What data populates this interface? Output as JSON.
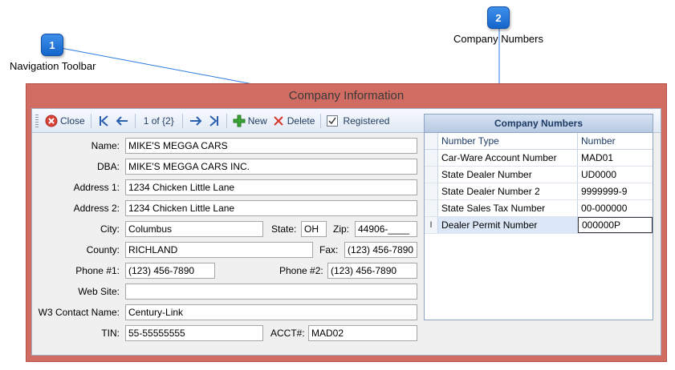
{
  "callouts": [
    {
      "number": "1",
      "label": "Navigation Toolbar"
    },
    {
      "number": "2",
      "label": "Company Numbers"
    }
  ],
  "window": {
    "title": "Company Information"
  },
  "toolbar": {
    "close": "Close",
    "record_position": "1 of {2}",
    "new": "New",
    "delete": "Delete",
    "registered": "Registered"
  },
  "form": {
    "name": {
      "label": "Name:",
      "value": "MIKE'S MEGGA CARS"
    },
    "dba": {
      "label": "DBA:",
      "value": "MIKE'S MEGGA CARS INC."
    },
    "address1": {
      "label": "Address 1:",
      "value": "1234 Chicken Little Lane"
    },
    "address2": {
      "label": "Address 2:",
      "value": "1234 Chicken Little Lane"
    },
    "city": {
      "label": "City:",
      "value": "Columbus"
    },
    "state": {
      "label": "State:",
      "value": "OH"
    },
    "zip": {
      "label": "Zip:",
      "value": "44906-____"
    },
    "county": {
      "label": "County:",
      "value": "RICHLAND"
    },
    "fax": {
      "label": "Fax:",
      "value": "(123) 456-7890"
    },
    "phone1": {
      "label": "Phone #1:",
      "value": "(123) 456-7890"
    },
    "phone2": {
      "label": "Phone #2:",
      "value": "(123) 456-7890"
    },
    "website": {
      "label": "Web Site:",
      "value": ""
    },
    "w3contact": {
      "label": "W3 Contact Name:",
      "value": "Century-Link"
    },
    "tin": {
      "label": "TIN:",
      "value": "55-55555555"
    },
    "acct": {
      "label": "ACCT#:",
      "value": "MAD02"
    }
  },
  "numbers_grid": {
    "title": "Company Numbers",
    "columns": [
      "Number Type",
      "Number"
    ],
    "rows": [
      {
        "type": "Car-Ware Account Number",
        "number": "MAD01"
      },
      {
        "type": "State Dealer Number",
        "number": "UD0000"
      },
      {
        "type": "State Dealer Number 2",
        "number": "9999999-9"
      },
      {
        "type": "State Sales Tax Number",
        "number": "00-000000"
      },
      {
        "type": "Dealer Permit Number",
        "number": "000000P"
      }
    ],
    "active_row_marker": "I"
  },
  "colors": {
    "window_frame": "#d16c62",
    "callout": "#1e74dd"
  }
}
